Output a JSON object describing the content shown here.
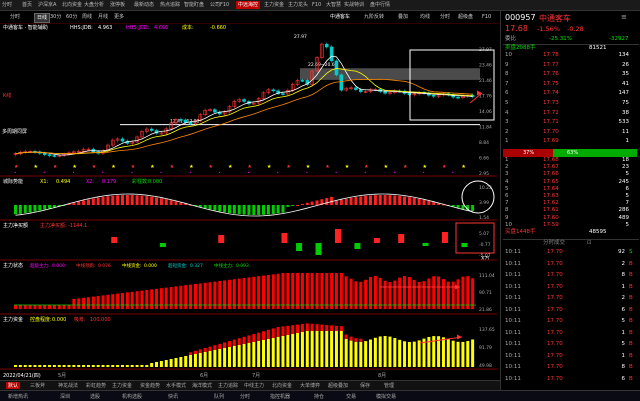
{
  "tabs": [
    "分时",
    "首页",
    "沪深京A",
    "北向资金",
    "大盘分析",
    "涨停板",
    "最新动态",
    "热点追踪",
    "智能盯盘",
    "公司F10",
    "中远海控",
    "主力资金",
    "主力龙头",
    "F10",
    "大智慧",
    "实战特训",
    "盘中行情"
  ],
  "active_tab_index": 10,
  "toolbar": {
    "periods": [
      "分时",
      "日线",
      "30分",
      "60分",
      "周线",
      "月线",
      "更多"
    ],
    "selected_period_index": 1,
    "stock_label": "中通客车",
    "indicator_btn": "九阶反转",
    "mode_btn": "叠加",
    "btns": [
      "均线",
      "分时",
      "超级盘",
      "F10"
    ],
    "timestamp": "2022/05/26"
  },
  "main_chart": {
    "title": "中通客车 · 智能辅助",
    "indicators": [
      {
        "label": "HHS:JDB:",
        "value": "4.963"
      },
      {
        "label": "HHS:JDD:",
        "value": "4.666"
      },
      {
        "label": "成本:",
        "value": "-0.660"
      }
    ],
    "scale": [
      "27.97",
      "23.46",
      "21.46",
      "17.76",
      "14.06",
      "11.84",
      "8.84",
      "6.66",
      "2.95"
    ],
    "annotations": [
      "27.97",
      "22.69~20.60",
      "12.41~12.81"
    ],
    "left_labels": [
      "K线",
      "多周期同屏"
    ]
  },
  "panel2": {
    "title": "城际势能",
    "items": [
      {
        "label": "X1:",
        "value": "0.494"
      },
      {
        "label": "X2:",
        "value": "0.179"
      },
      {
        "label": "彩柱数:",
        "value": "0.000"
      }
    ],
    "scale": [
      "10.22",
      "3.99",
      "1.54"
    ]
  },
  "panel3": {
    "title": "主力净买额",
    "items": [
      {
        "label": "主力净买额:",
        "value": "-1144.1"
      }
    ],
    "scale": [
      "5.07",
      "-0.77",
      "-5.07"
    ],
    "unit": "X万"
  },
  "panel4": {
    "title": "主力状态",
    "items": [
      {
        "label": "超级主力:",
        "value": "0.000"
      },
      {
        "label": "中线领跑:",
        "value": "0.076"
      },
      {
        "label": "中线资金:",
        "value": "0.000"
      },
      {
        "label": "超短资金:",
        "value": "0.327"
      },
      {
        "label": "中线主力:",
        "value": "0.093"
      }
    ],
    "scale": [
      "111.04",
      "90.71",
      "21.86"
    ]
  },
  "panel5": {
    "title": "主力资金",
    "items": [
      {
        "label": "控盘程度:",
        "value": "0.000"
      },
      {
        "label": "吸筹:",
        "value": "100.000"
      }
    ],
    "scale": [
      "137.65",
      "91.79",
      "49.98"
    ]
  },
  "x_axis": {
    "date": "2022/04/21(四)",
    "months": [
      "5月",
      "6月",
      "7月",
      "8月"
    ]
  },
  "right": {
    "code": "000957",
    "name": "中通客车",
    "price": "17.68",
    "change_pct": "-1.56%",
    "change": "-0.28",
    "wei_bi_label": "委比",
    "wei_bi": "-25.31%",
    "wei_cha": "-32927",
    "sell_header": "卖盘2088手",
    "sell_header_vol": "81521",
    "asks": [
      {
        "label": "10",
        "price": "17.78",
        "vol": "134"
      },
      {
        "label": "9",
        "price": "17.77",
        "vol": "26"
      },
      {
        "label": "8",
        "price": "17.76",
        "vol": "35"
      },
      {
        "label": "7",
        "price": "17.75",
        "vol": "41"
      },
      {
        "label": "6",
        "price": "17.74",
        "vol": "147"
      },
      {
        "label": "5",
        "price": "17.73",
        "vol": "75"
      },
      {
        "label": "4",
        "price": "17.72",
        "vol": "38"
      },
      {
        "label": "3",
        "price": "17.71",
        "vol": "533"
      },
      {
        "label": "2",
        "price": "17.70",
        "vol": "11"
      },
      {
        "label": "1",
        "price": "17.69",
        "vol": "1"
      }
    ],
    "ratio_left": "37%",
    "ratio_right": "63%",
    "bids": [
      {
        "label": "1",
        "price": "17.68",
        "vol": "18"
      },
      {
        "label": "2",
        "price": "17.67",
        "vol": "23"
      },
      {
        "label": "3",
        "price": "17.66",
        "vol": "5"
      },
      {
        "label": "4",
        "price": "17.65",
        "vol": "245"
      },
      {
        "label": "5",
        "price": "17.64",
        "vol": "6"
      },
      {
        "label": "6",
        "price": "17.63",
        "vol": "5"
      },
      {
        "label": "7",
        "price": "17.62",
        "vol": "7"
      },
      {
        "label": "8",
        "price": "17.61",
        "vol": "286"
      },
      {
        "label": "9",
        "price": "17.60",
        "vol": "489"
      },
      {
        "label": "10",
        "price": "17.59",
        "vol": "5"
      }
    ],
    "buy_header": "买盘1448手",
    "buy_header_vol": "48595",
    "ticks_title": "分时成交",
    "ticks": [
      {
        "time": "10:11",
        "price": "17.70",
        "vol": "92",
        "flag": "S"
      },
      {
        "time": "10:11",
        "price": "17.70",
        "vol": "2",
        "flag": "B"
      },
      {
        "time": "10:11",
        "price": "17.70",
        "vol": "8",
        "flag": "B"
      },
      {
        "time": "10:11",
        "price": "17.70",
        "vol": "1",
        "flag": "B"
      },
      {
        "time": "10:11",
        "price": "17.70",
        "vol": "2",
        "flag": "B"
      },
      {
        "time": "10:11",
        "price": "17.70",
        "vol": "6",
        "flag": "B"
      },
      {
        "time": "10:11",
        "price": "17.70",
        "vol": "5",
        "flag": "B"
      },
      {
        "time": "10:11",
        "price": "17.70",
        "vol": "1",
        "flag": "B"
      },
      {
        "time": "10:11",
        "price": "17.70",
        "vol": "5",
        "flag": "B"
      },
      {
        "time": "10:11",
        "price": "17.70",
        "vol": "1",
        "flag": "B"
      },
      {
        "time": "10:11",
        "price": "17.70",
        "vol": "8",
        "flag": "B"
      },
      {
        "time": "10:11",
        "price": "17.70",
        "vol": "6",
        "flag": "B"
      }
    ]
  },
  "bottom_tabs": [
    "默认",
    "三板斧",
    "神龙战法",
    "彩虹趋势",
    "主力资金",
    "资金趋势",
    "水手模式",
    "海洋模式",
    "主力追踪",
    "中线主力",
    "北向资金",
    "大单博弈",
    "超级叠加",
    "保存",
    "管理"
  ],
  "status_bar": [
    "新增热讯",
    "深圳",
    "选股",
    "机构选股",
    "快讯",
    "队列",
    "分时",
    "指控机器",
    "持仓",
    "交易",
    "模拟交易"
  ],
  "colors": {
    "up": "#ff2020",
    "down": "#00e060",
    "ma1": "#ffff00",
    "ma2": "#ff8000",
    "accent": "#b00000"
  }
}
